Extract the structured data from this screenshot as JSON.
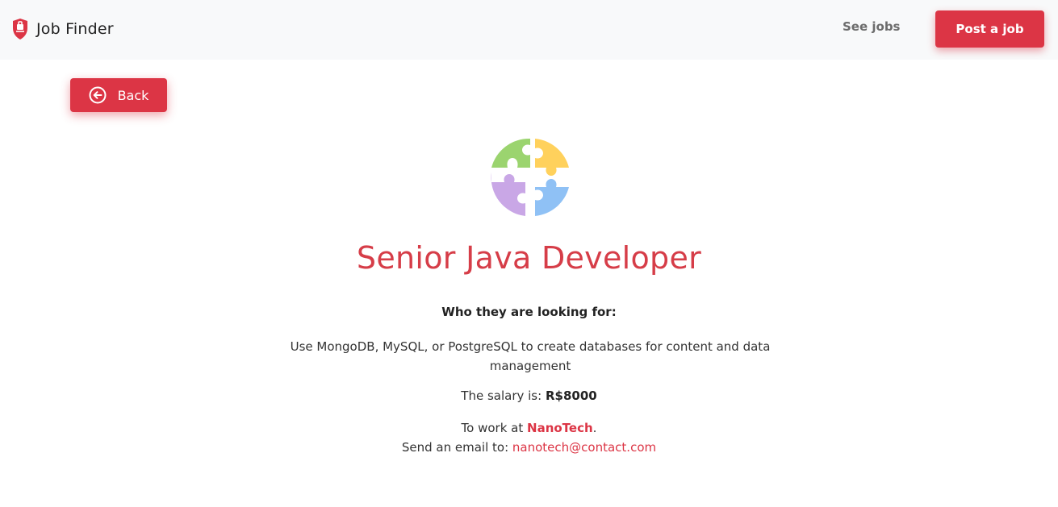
{
  "header": {
    "brand_name": "Job Finder",
    "brand_icon": "shield-icon",
    "nav": {
      "see_jobs_label": "See jobs",
      "post_job_label": "Post a job"
    }
  },
  "back_button": {
    "label": "Back",
    "icon": "arrow-left-circle-icon"
  },
  "job": {
    "logo_icon": "puzzle-icon",
    "title": "Senior Java Developer",
    "looking_for_heading": "Who they are looking for:",
    "description": "Use MongoDB, MySQL, or PostgreSQL to create databases for content and data management",
    "salary_prefix": "The salary is:",
    "salary_value": "R$8000",
    "company_prefix": "To work at",
    "company_name": "NanoTech",
    "company_suffix": ".",
    "email_prefix": "Send an email to:",
    "email": "nanotech@contact.com"
  },
  "colors": {
    "accent": "#dc3545",
    "navbar_bg": "#f8f9fa",
    "puzzle_green": "#9bd46f",
    "puzzle_yellow": "#ffd15c",
    "puzzle_purple": "#c9a7e6",
    "puzzle_blue": "#8fc1f5"
  }
}
